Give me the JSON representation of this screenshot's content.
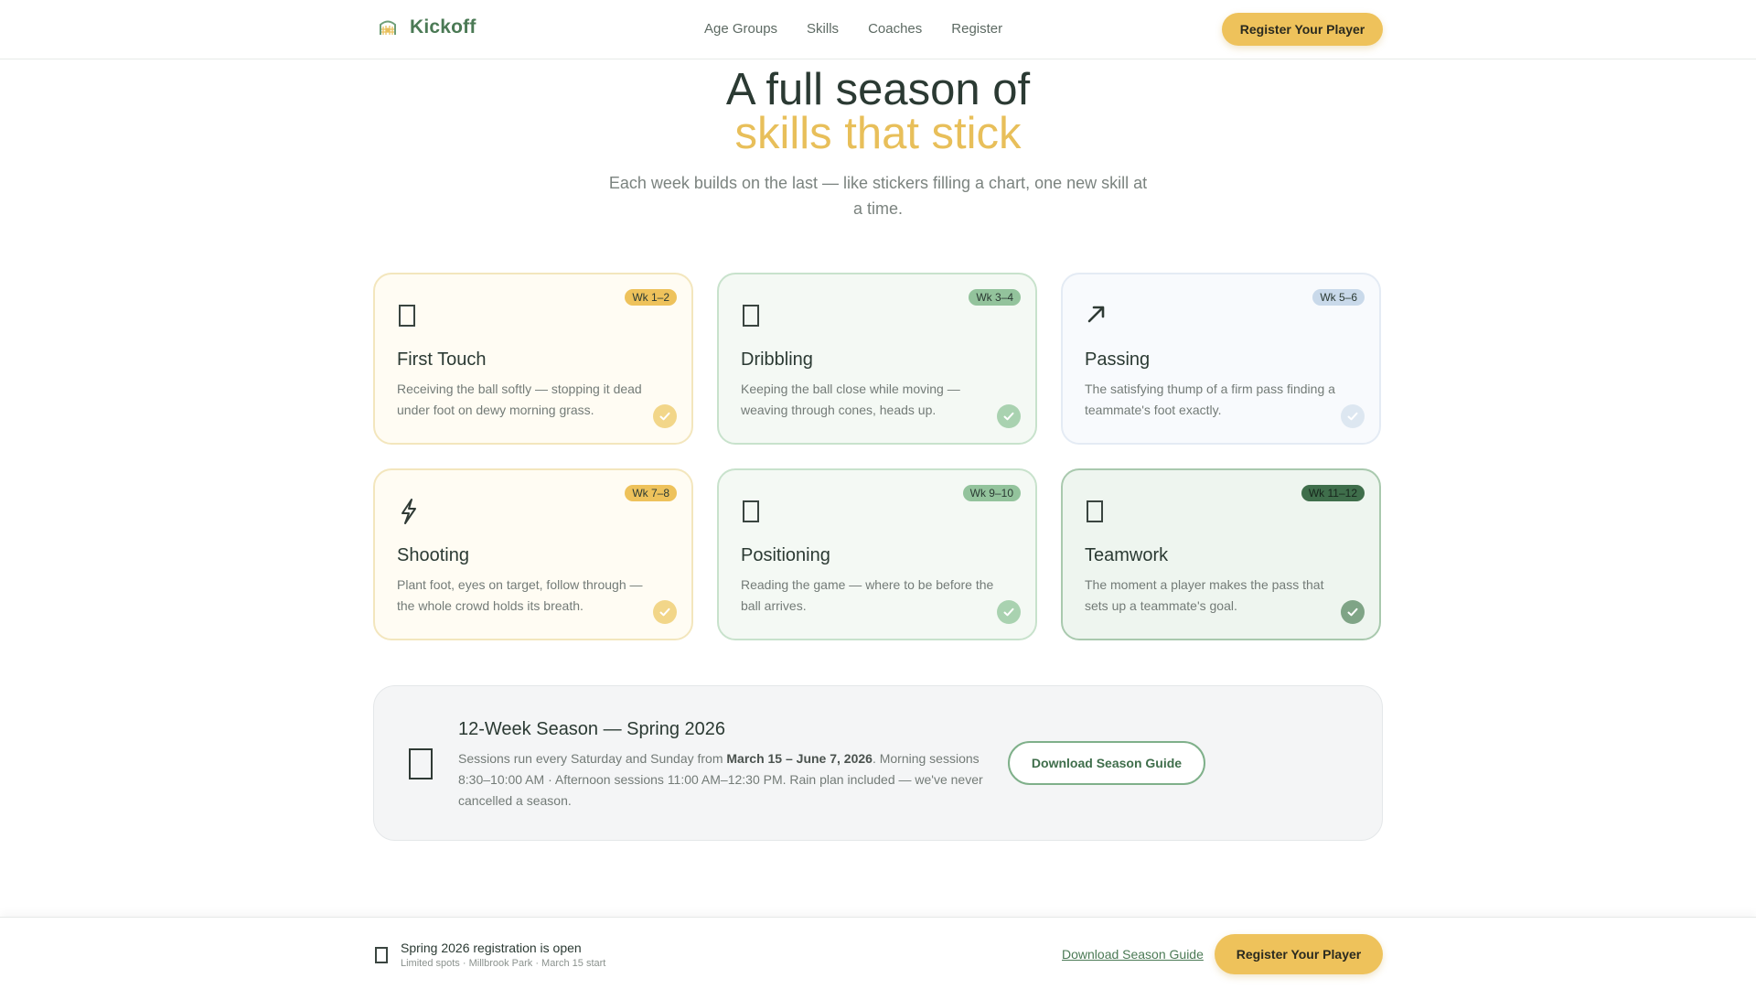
{
  "header": {
    "brand": "Kickoff",
    "nav": [
      "Age Groups",
      "Skills",
      "Coaches",
      "Register"
    ],
    "cta": "Register Your Player"
  },
  "hero": {
    "line1": "A full season of",
    "line2": "skills that stick",
    "subtitle": "Each week builds on the last — like stickers filling a chart, one new skill at a time."
  },
  "skills": [
    {
      "badge": "Wk 1–2",
      "icon": "square-placeholder-icon",
      "title": "First Touch",
      "desc": "Receiving the ball softly — stopping it dead under foot on dewy morning grass.",
      "theme": "yellow"
    },
    {
      "badge": "Wk 3–4",
      "icon": "square-placeholder-icon",
      "title": "Dribbling",
      "desc": "Keeping the ball close while moving — weaving through cones, heads up.",
      "theme": "green"
    },
    {
      "badge": "Wk 5–6",
      "icon": "arrow-up-right-icon",
      "title": "Passing",
      "desc": "The satisfying thump of a firm pass finding a teammate's foot exactly.",
      "theme": "blue"
    },
    {
      "badge": "Wk 7–8",
      "icon": "lightning-icon",
      "title": "Shooting",
      "desc": "Plant foot, eyes on target, follow through — the whole crowd holds its breath.",
      "theme": "yellow"
    },
    {
      "badge": "Wk 9–10",
      "icon": "square-placeholder-icon",
      "title": "Positioning",
      "desc": "Reading the game — where to be before the ball arrives.",
      "theme": "green"
    },
    {
      "badge": "Wk 11–12",
      "icon": "square-placeholder-icon",
      "title": "Teamwork",
      "desc": "The moment a player makes the pass that sets up a teammate's goal.",
      "theme": "dark"
    }
  ],
  "season": {
    "title": "12-Week Season — Spring 2026",
    "desc_prefix": "Sessions run every Saturday and Sunday from ",
    "desc_dates": "March 15 – June 7, 2026",
    "desc_suffix": ". Morning sessions 8:30–10:00 AM · Afternoon sessions 11:00 AM–12:30 PM. Rain plan included — we've never cancelled a season.",
    "button": "Download Season Guide"
  },
  "bottom_bar": {
    "title": "Spring 2026 registration is open",
    "subtitle": "Limited spots · Millbrook Park · March 15 start",
    "link": "Download Season Guide",
    "cta": "Register Your Player"
  },
  "colors": {
    "brand_green": "#4b7a55",
    "accent_yellow": "#eec25b",
    "text_dark": "#2b3a33",
    "text_muted": "#737b77"
  }
}
